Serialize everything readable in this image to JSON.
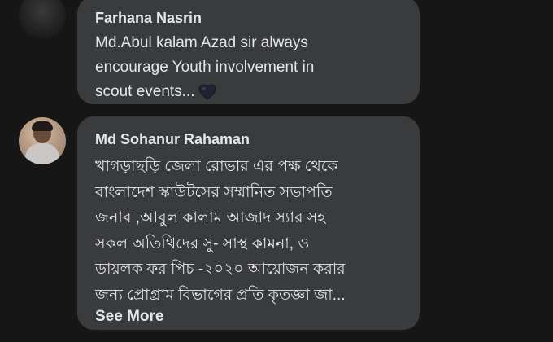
{
  "comments": [
    {
      "author": "Farhana Nasrin",
      "text_lines": [
        "Md.Abul kalam Azad sir always",
        "encourage Youth involvement in",
        "scout events..."
      ],
      "emoji": "black-heart-icon"
    },
    {
      "author": "Md Sohanur Rahaman",
      "text_lines": [
        "খাগড়াছড়ি জেলা রোভার এর পক্ষ থেকে",
        "বাংলাদেশ স্কাউটসের সম্মানিত সভাপতি",
        "জনাব ,আবুল কালাম আজাদ স্যার সহ",
        "সকল অতিথিদের সু- সাস্থ কামনা, ও",
        "ডায়লক ফর পিচ -২০২০ আয়োজন করার",
        "জন্য প্রোগ্রাম বিভাগের প্রতি কৃতজ্ঞা জা..."
      ],
      "see_more": "See More"
    }
  ],
  "colors": {
    "background": "#161616",
    "bubble": "#3a3b3c",
    "text": "#e4e6eb"
  }
}
